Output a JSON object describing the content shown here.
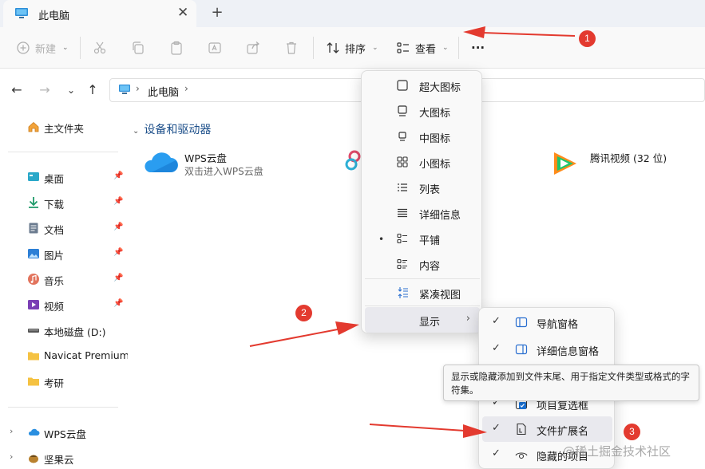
{
  "tab": {
    "title": "此电脑",
    "close": "✕",
    "new_tab": "+"
  },
  "toolbar": {
    "new_label": "新建",
    "sort_label": "排序",
    "view_label": "查看",
    "more_label": "···"
  },
  "address": {
    "crumb": "此电脑",
    "sep": "›"
  },
  "sidebar": {
    "items": [
      {
        "label": "主文件夹",
        "icon": "home-icon"
      },
      {
        "label": "桌面",
        "icon": "desktop-icon",
        "pinned": true
      },
      {
        "label": "下载",
        "icon": "download-icon",
        "pinned": true
      },
      {
        "label": "文档",
        "icon": "document-icon",
        "pinned": true
      },
      {
        "label": "图片",
        "icon": "picture-icon",
        "pinned": true
      },
      {
        "label": "音乐",
        "icon": "music-icon",
        "pinned": true
      },
      {
        "label": "视频",
        "icon": "video-icon",
        "pinned": true
      },
      {
        "label": "本地磁盘 (D:)",
        "icon": "drive-icon"
      },
      {
        "label": "Navicat Premium",
        "icon": "folder-icon"
      },
      {
        "label": "考研",
        "icon": "folder-icon"
      },
      {
        "label": "WPS云盘",
        "icon": "cloud-icon"
      },
      {
        "label": "坚果云",
        "icon": "nut-icon"
      }
    ]
  },
  "main": {
    "group": "设备和驱动器",
    "wps": {
      "name": "WPS云盘",
      "sub": "双击进入WPS云盘"
    },
    "tencent": {
      "name": "腾讯视频 (32 位)"
    }
  },
  "view_menu": {
    "items": [
      {
        "label": "超大图标",
        "icon": "extra-large-icons-icon"
      },
      {
        "label": "大图标",
        "icon": "large-icons-icon"
      },
      {
        "label": "中图标",
        "icon": "medium-icons-icon"
      },
      {
        "label": "小图标",
        "icon": "small-icons-icon"
      },
      {
        "label": "列表",
        "icon": "list-icon"
      },
      {
        "label": "详细信息",
        "icon": "details-icon"
      },
      {
        "label": "平铺",
        "icon": "tiles-icon",
        "selected": true
      },
      {
        "label": "内容",
        "icon": "content-icon"
      },
      {
        "label": "紧凑视图",
        "icon": "compact-view-icon"
      },
      {
        "label": "显示",
        "has_submenu": true
      }
    ],
    "selected_dot": "•",
    "submenu_arrow": "›"
  },
  "show_submenu": {
    "items": [
      {
        "label": "导航窗格",
        "checked": true,
        "icon": "navigation-pane-icon"
      },
      {
        "label": "详细信息窗格",
        "checked": true,
        "icon": "details-pane-icon"
      },
      {
        "label": "项目复选框",
        "checked": true,
        "icon": "checkbox-icon"
      },
      {
        "label": "文件扩展名",
        "checked": true,
        "icon": "file-extension-icon"
      },
      {
        "label": "隐藏的项目",
        "checked": true,
        "icon": "eye-icon"
      }
    ],
    "check": "✓"
  },
  "tooltip": {
    "text": "显示或隐藏添加到文件末尾、用于指定文件类型或格式的字符集。"
  },
  "annotations": {
    "badge1": "1",
    "badge2": "2",
    "badge3": "3"
  },
  "watermark": "@稀土掘金技术社区",
  "colors": {
    "accent": "#1c4f8a",
    "annotation": "#e33a2f",
    "menu_bg": "#f9f9f9"
  }
}
